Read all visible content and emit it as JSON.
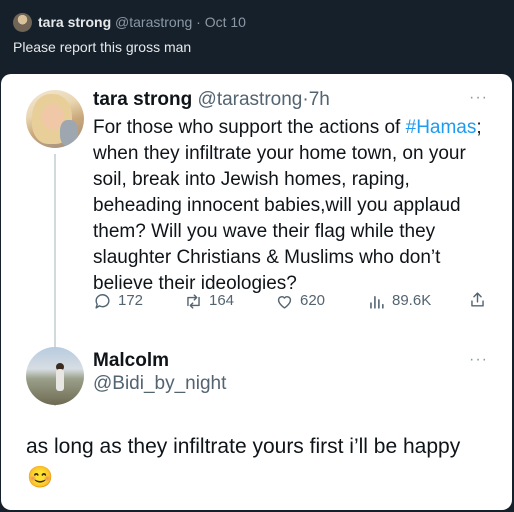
{
  "outer_tweet": {
    "author_name": "tara strong",
    "handle": "@tarastrong",
    "separator": "·",
    "date": "Oct 10",
    "text": "Please report this gross man"
  },
  "quoted_tweet": {
    "author_name": "tara strong",
    "handle": "@tarastrong",
    "separator": "·",
    "time": "7h",
    "more_icon": "···",
    "body_before_tag": "For those who support the actions of ",
    "hashtag": "#Hamas",
    "body_after_tag": "; when they infiltrate your home town, on your soil, break into Jewish homes, raping, beheading innocent babies,will you applaud them? Will you wave their flag while they slaughter Christians & Muslims who don’t believe their ideologies?",
    "actions": {
      "replies": "172",
      "retweets": "164",
      "likes": "620",
      "views": "89.6K"
    }
  },
  "reply_tweet": {
    "author_name": "Malcolm",
    "handle": "@Bidi_by_night",
    "more_icon": "···",
    "body": "as long as they infiltrate yours first i’ll be happy",
    "emoji": "😊"
  },
  "colors": {
    "dark_bg": "#15202b",
    "card_bg": "#ffffff",
    "link_blue": "#1d9bf0",
    "muted_text": "#536471"
  },
  "icons": [
    "reply-icon",
    "retweet-icon",
    "like-icon",
    "views-icon",
    "share-icon",
    "more-icon"
  ]
}
